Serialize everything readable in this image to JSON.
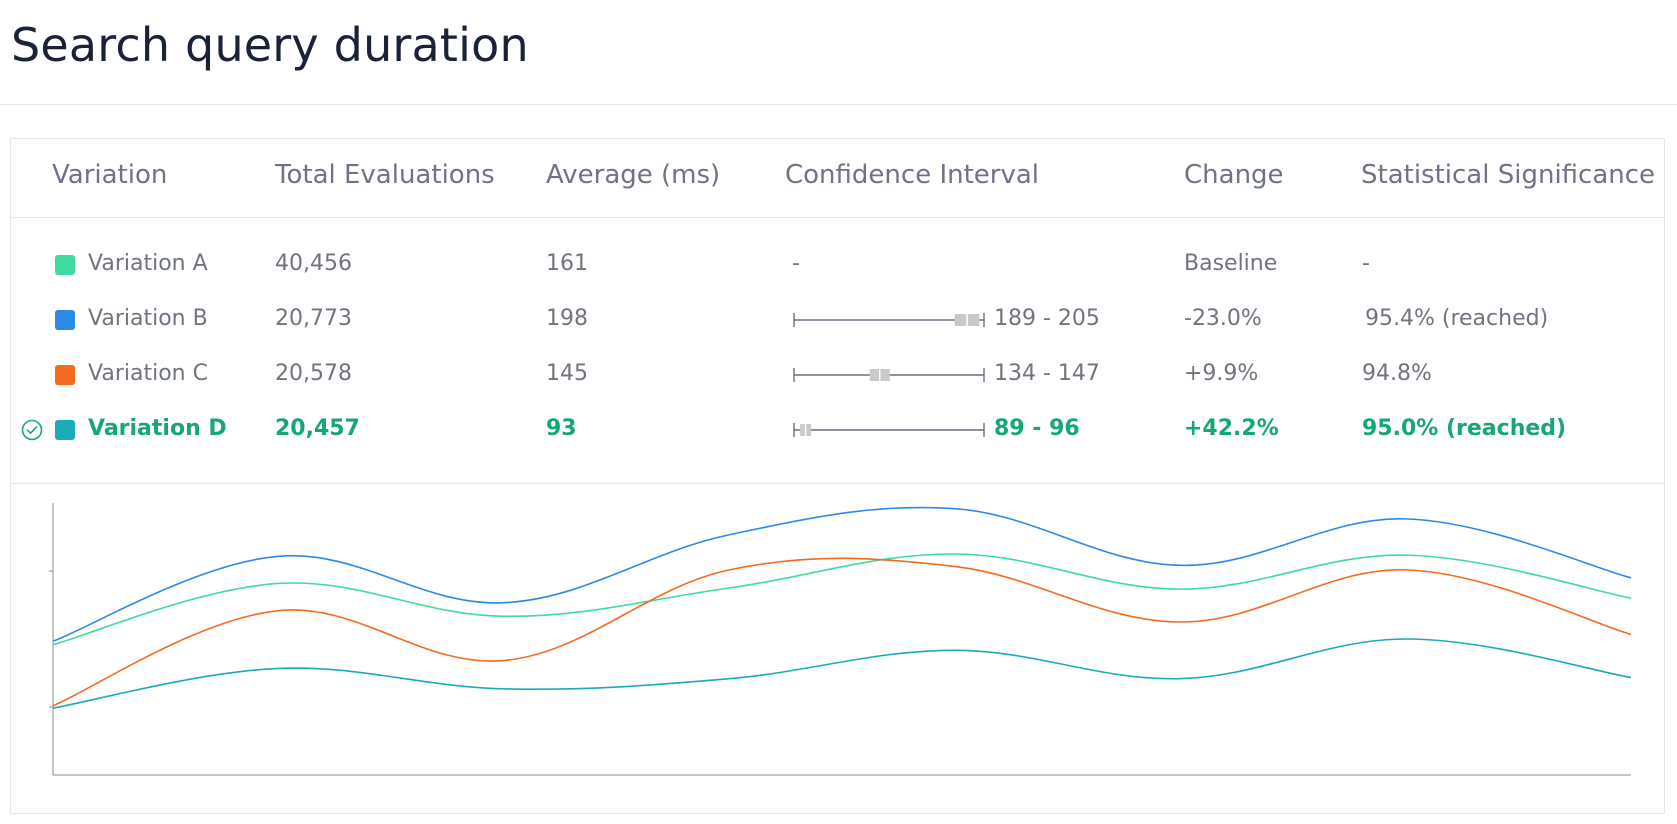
{
  "page": {
    "title": "Search query duration"
  },
  "table": {
    "headers": {
      "variation": "Variation",
      "total": "Total Evaluations",
      "average": "Average (ms)",
      "ci": "Confidence Interval",
      "change": "Change",
      "significance": "Statistical Significance"
    },
    "rows": [
      {
        "name": "Variation A",
        "color": "#3ddba0",
        "total": "40,456",
        "average": "161",
        "ci_text": "-",
        "ci": null,
        "change": "Baseline",
        "significance": "-",
        "winner": false
      },
      {
        "name": "Variation B",
        "color": "#2b8ae6",
        "total": "20,773",
        "average": "198",
        "ci_text": "189 - 205",
        "ci": {
          "low": 189,
          "high": 205
        },
        "change": "-23.0%",
        "significance": "95.4% (reached)",
        "winner": false
      },
      {
        "name": "Variation C",
        "color": "#f36b1c",
        "total": "20,578",
        "average": "145",
        "ci_text": "134 - 147",
        "ci": {
          "low": 134,
          "high": 147
        },
        "change": "+9.9%",
        "significance": "94.8%",
        "winner": false
      },
      {
        "name": "Variation D",
        "color": "#1aaab8",
        "total": "20,457",
        "average": "93",
        "ci_text": "89 - 96",
        "ci": {
          "low": 89,
          "high": 96
        },
        "change": "+42.2%",
        "significance": "95.0% (reached)",
        "winner": true
      }
    ]
  },
  "chart_data": {
    "type": "line",
    "title": "",
    "xlabel": "",
    "ylabel": "",
    "x": [
      0,
      1,
      2,
      3,
      4,
      5,
      6,
      7
    ],
    "ylim": [
      0,
      240
    ],
    "grid": false,
    "series": [
      {
        "color": "#2b8ae6",
        "values": [
          118,
          193,
          152,
          212,
          235,
          185,
          226,
          174
        ]
      },
      {
        "color": "#3ddba0",
        "values": [
          115,
          169,
          140,
          165,
          195,
          164,
          194,
          156
        ]
      },
      {
        "color": "#f36b1c",
        "values": [
          61,
          145,
          101,
          181,
          184,
          135,
          181,
          124
        ]
      },
      {
        "color": "#1aaab8",
        "values": [
          59,
          94,
          76,
          85,
          110,
          85,
          120,
          86
        ]
      }
    ]
  }
}
